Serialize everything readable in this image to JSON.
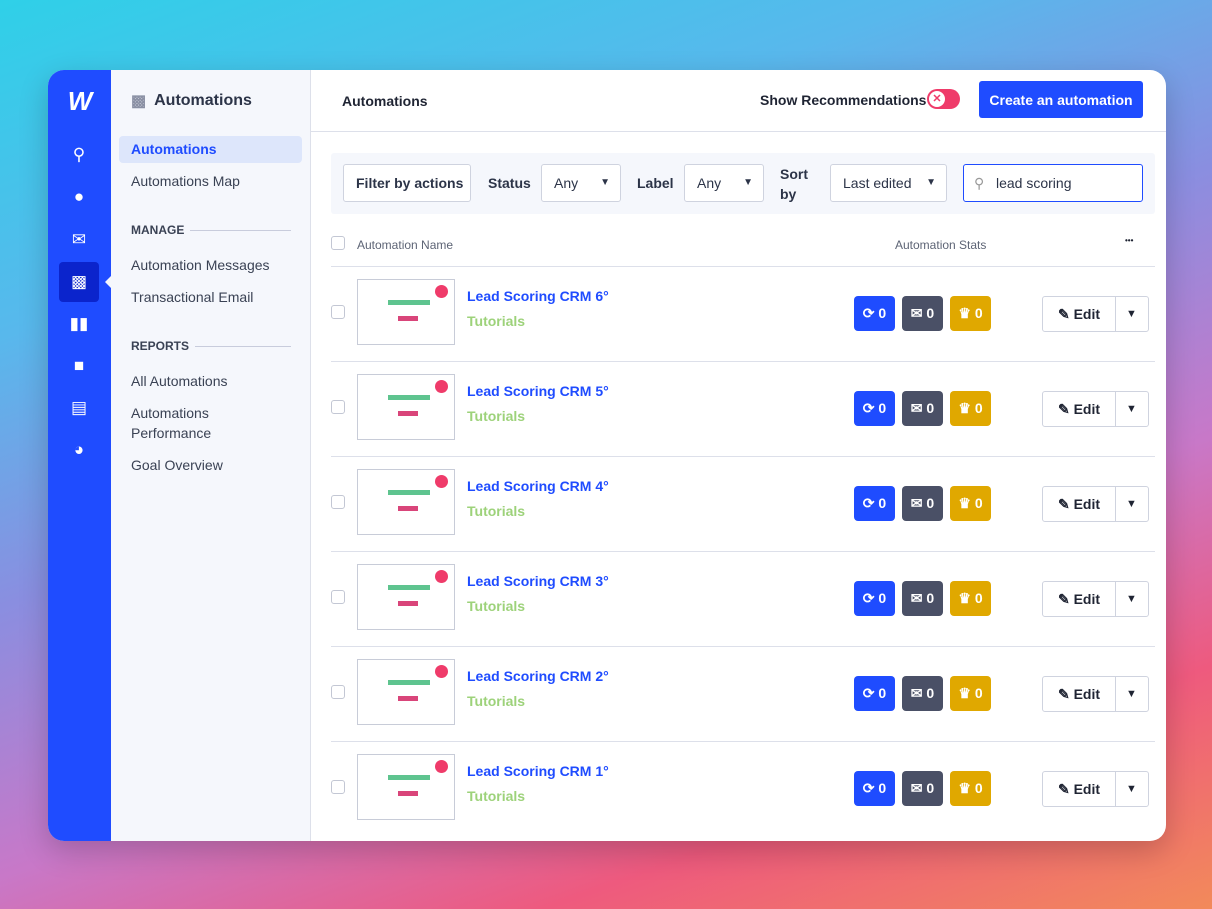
{
  "sidebar": {
    "title": "Automations",
    "items": [
      "Automations",
      "Automations Map"
    ],
    "manage_heading": "MANAGE",
    "manage_items": [
      "Automation Messages",
      "Transactional Email"
    ],
    "reports_heading": "REPORTS",
    "reports_items": [
      "All Automations",
      "Automations Performance",
      "Goal Overview"
    ]
  },
  "rail": {
    "icons": [
      "search-icon",
      "contacts-icon",
      "email-icon",
      "automations-icon",
      "pipeline-icon",
      "conversations-icon",
      "site-icon",
      "reports-icon"
    ],
    "active": "automations-icon"
  },
  "header": {
    "title": "Automations",
    "show_recommendations": "Show Recommendations",
    "recommendations_on": false,
    "create_label": "Create an automation"
  },
  "filters": {
    "filter_by_actions": "Filter by actions",
    "status_label": "Status",
    "status_value": "Any",
    "label_label": "Label",
    "label_value": "Any",
    "sort_label": "Sort by",
    "sort_value": "Last edited",
    "search_value": "lead scoring"
  },
  "table": {
    "col_name": "Automation Name",
    "col_stats": "Automation Stats",
    "more": "•••",
    "edit_label": "Edit",
    "rows": [
      {
        "name": "Lead Scoring CRM 6°",
        "label": "Tutorials",
        "active": "0",
        "emails": "0",
        "goals": "0"
      },
      {
        "name": "Lead Scoring CRM 5°",
        "label": "Tutorials",
        "active": "0",
        "emails": "0",
        "goals": "0"
      },
      {
        "name": "Lead Scoring CRM 4°",
        "label": "Tutorials",
        "active": "0",
        "emails": "0",
        "goals": "0"
      },
      {
        "name": "Lead Scoring CRM 3°",
        "label": "Tutorials",
        "active": "0",
        "emails": "0",
        "goals": "0"
      },
      {
        "name": "Lead Scoring CRM 2°",
        "label": "Tutorials",
        "active": "0",
        "emails": "0",
        "goals": "0"
      },
      {
        "name": "Lead Scoring CRM 1°",
        "label": "Tutorials",
        "active": "0",
        "emails": "0",
        "goals": "0"
      }
    ]
  },
  "colors": {
    "accent": "#1f4cff",
    "stat_active": "#1f4cff",
    "stat_email": "#4a5066",
    "stat_goal": "#e0a800",
    "label": "#9dd27a",
    "toggle": "#ef3b6a"
  }
}
